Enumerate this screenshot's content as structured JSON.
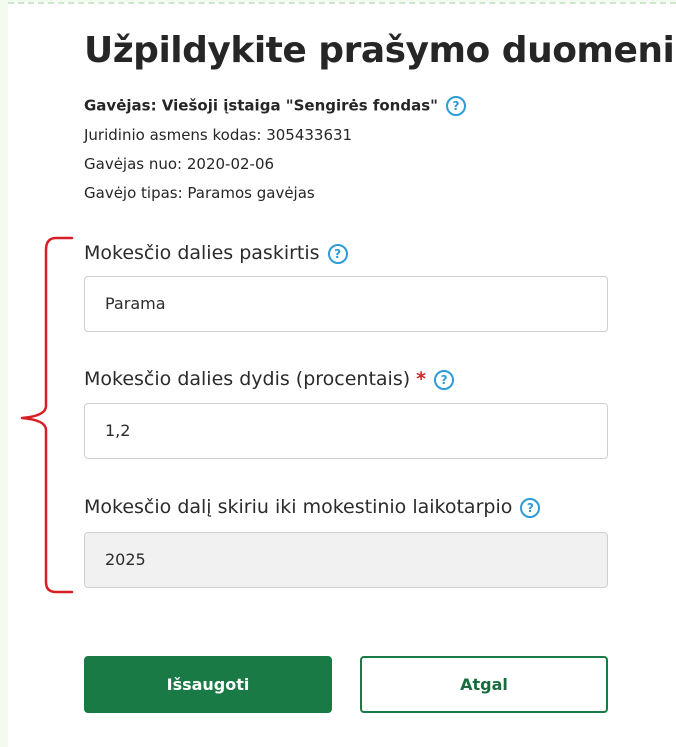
{
  "title": "Užpildykite prašymo duomenis",
  "recipient": {
    "line1": "Gavėjas:  Viešoji įstaiga \"Sengirės fondas\"",
    "line2": "Juridinio asmens kodas: 305433631",
    "line3": "Gavėjas nuo: 2020-02-06",
    "line4": "Gavėjo tipas: Paramos gavėjas"
  },
  "fields": {
    "purpose": {
      "label": "Mokesčio dalies paskirtis",
      "value": "Parama"
    },
    "percent": {
      "label": "Mokesčio dalies dydis (procentais)",
      "required_mark": "*",
      "value": "1,2"
    },
    "period": {
      "label": "Mokesčio dalį skiriu iki mokestinio laikotarpio",
      "value": "2025"
    }
  },
  "help_glyph": "?",
  "buttons": {
    "save": "Išsaugoti",
    "back": "Atgal"
  },
  "colors": {
    "primary_green": "#1a7a45",
    "help_blue": "#2d9bd6",
    "required_red": "#d32626",
    "annotation_red": "#d81f26",
    "page_background": "#f3fbf1"
  },
  "icons": {
    "help": "question-circle-icon",
    "annotation": "curly-bracket"
  }
}
